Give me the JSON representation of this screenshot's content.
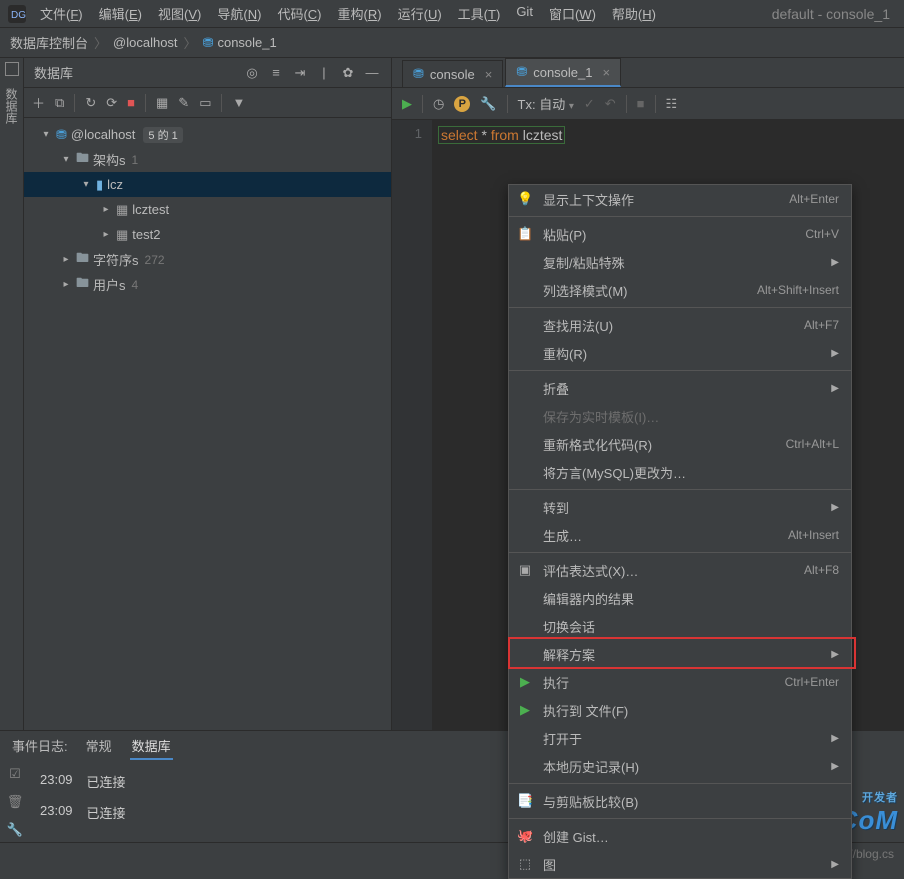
{
  "window": {
    "title": "default - console_1"
  },
  "menu": [
    {
      "t": "文件",
      "k": "F"
    },
    {
      "t": "编辑",
      "k": "E"
    },
    {
      "t": "视图",
      "k": "V"
    },
    {
      "t": "导航",
      "k": "N"
    },
    {
      "t": "代码",
      "k": "C"
    },
    {
      "t": "重构",
      "k": "R"
    },
    {
      "t": "运行",
      "k": "U"
    },
    {
      "t": "工具",
      "k": "T"
    },
    {
      "t": "Git",
      "k": ""
    },
    {
      "t": "窗口",
      "k": "W"
    },
    {
      "t": "帮助",
      "k": "H"
    }
  ],
  "breadcrumb": [
    "数据库控制台",
    "@localhost",
    "console_1"
  ],
  "side_tab": {
    "label": "数据库"
  },
  "db_panel": {
    "title": "数据库",
    "tree": [
      {
        "indent": 0,
        "chev": "v",
        "icon": "db",
        "text": "@localhost",
        "badge": "5 的 1",
        "sel": false
      },
      {
        "indent": 1,
        "chev": "v",
        "icon": "folder",
        "text": "架构s",
        "badge": "1",
        "sel": false
      },
      {
        "indent": 2,
        "chev": "v",
        "icon": "schema",
        "text": "lcz",
        "badge": "",
        "sel": true
      },
      {
        "indent": 3,
        "chev": ">",
        "icon": "table",
        "text": "lcztest",
        "badge": "",
        "sel": false
      },
      {
        "indent": 3,
        "chev": ">",
        "icon": "table",
        "text": "test2",
        "badge": "",
        "sel": false
      },
      {
        "indent": 1,
        "chev": ">",
        "icon": "folder",
        "text": "字符序s",
        "badge": "272",
        "sel": false
      },
      {
        "indent": 1,
        "chev": ">",
        "icon": "folder",
        "text": "用户s",
        "badge": "4",
        "sel": false
      }
    ]
  },
  "tabs": [
    {
      "label": "console",
      "active": false
    },
    {
      "label": "console_1",
      "active": true
    }
  ],
  "ed_toolbar": {
    "tx_label": "Tx: 自动"
  },
  "code": {
    "line_no": "1",
    "kw1": "select",
    "star": "*",
    "kw2": "from",
    "tbl": "lcztest"
  },
  "context_menu": [
    {
      "type": "item",
      "icon": "bulb",
      "label": "显示上下文操作",
      "sc": "Alt+Enter"
    },
    {
      "type": "sep"
    },
    {
      "type": "item",
      "icon": "paste",
      "label": "粘贴(P)",
      "sc": "Ctrl+V"
    },
    {
      "type": "item",
      "icon": "",
      "label": "复制/粘贴特殊",
      "sc": "",
      "arrow": true
    },
    {
      "type": "item",
      "icon": "",
      "label": "列选择模式(M)",
      "sc": "Alt+Shift+Insert"
    },
    {
      "type": "sep"
    },
    {
      "type": "item",
      "icon": "",
      "label": "查找用法(U)",
      "sc": "Alt+F7"
    },
    {
      "type": "item",
      "icon": "",
      "label": "重构(R)",
      "sc": "",
      "arrow": true
    },
    {
      "type": "sep"
    },
    {
      "type": "item",
      "icon": "",
      "label": "折叠",
      "sc": "",
      "arrow": true
    },
    {
      "type": "item",
      "icon": "",
      "label": "保存为实时模板(I)…",
      "sc": "",
      "disabled": true
    },
    {
      "type": "item",
      "icon": "",
      "label": "重新格式化代码(R)",
      "sc": "Ctrl+Alt+L"
    },
    {
      "type": "item",
      "icon": "",
      "label": "将方言(MySQL)更改为…",
      "sc": ""
    },
    {
      "type": "sep"
    },
    {
      "type": "item",
      "icon": "",
      "label": "转到",
      "sc": "",
      "arrow": true
    },
    {
      "type": "item",
      "icon": "",
      "label": "生成…",
      "sc": "Alt+Insert"
    },
    {
      "type": "sep"
    },
    {
      "type": "item",
      "icon": "eval",
      "label": "评估表达式(X)…",
      "sc": "Alt+F8"
    },
    {
      "type": "item",
      "icon": "",
      "label": "编辑器内的结果",
      "sc": ""
    },
    {
      "type": "item",
      "icon": "",
      "label": "切换会话",
      "sc": ""
    },
    {
      "type": "item",
      "icon": "",
      "label": "解释方案",
      "sc": "",
      "arrow": true
    },
    {
      "type": "item",
      "icon": "play",
      "label": "执行",
      "sc": "Ctrl+Enter",
      "hl": true
    },
    {
      "type": "item",
      "icon": "play",
      "label": "执行到 文件(F)",
      "sc": ""
    },
    {
      "type": "item",
      "icon": "",
      "label": "打开于",
      "sc": "",
      "arrow": true
    },
    {
      "type": "item",
      "icon": "",
      "label": "本地历史记录(H)",
      "sc": "",
      "arrow": true
    },
    {
      "type": "sep"
    },
    {
      "type": "item",
      "icon": "clip",
      "label": "与剪贴板比较(B)",
      "sc": ""
    },
    {
      "type": "sep"
    },
    {
      "type": "item",
      "icon": "gh",
      "label": "创建 Gist…",
      "sc": ""
    },
    {
      "type": "item",
      "icon": "diag",
      "label": "图",
      "sc": "",
      "arrow": true
    }
  ],
  "bottom_tabs": {
    "prefix": "事件日志:",
    "items": [
      {
        "t": "常规",
        "a": false
      },
      {
        "t": "数据库",
        "a": true
      }
    ]
  },
  "log": [
    {
      "time": "23:09",
      "msg": "已连接"
    },
    {
      "time": "23:09",
      "msg": "已连接"
    }
  ],
  "status": {
    "right": "https://blog.cs"
  },
  "watermark": {
    "main": "DevZe.CoM",
    "sub": "开发者"
  }
}
